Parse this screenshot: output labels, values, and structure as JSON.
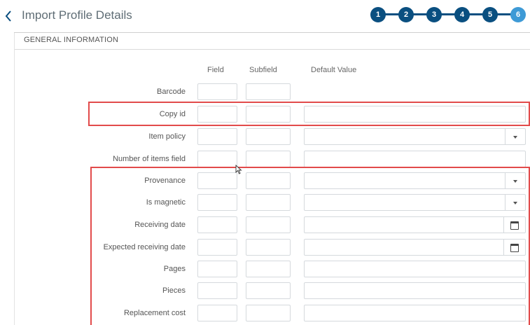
{
  "header": {
    "back_icon": "chevron-left-icon",
    "title": "Import Profile Details",
    "steps": [
      "1",
      "2",
      "3",
      "4",
      "5",
      "6"
    ],
    "active_step": "6"
  },
  "section": {
    "title": "GENERAL INFORMATION",
    "columns": {
      "field": "Field",
      "subfield": "Subfield",
      "default_value": "Default Value"
    }
  },
  "rows": [
    {
      "label": "Barcode",
      "default_control": "none"
    },
    {
      "label": "Copy id",
      "default_control": "text"
    },
    {
      "label": "Item policy",
      "default_control": "dropdown"
    },
    {
      "label": "Number of items field",
      "default_control": "text"
    },
    {
      "label": "Provenance",
      "default_control": "dropdown"
    },
    {
      "label": "Is magnetic",
      "default_control": "dropdown"
    },
    {
      "label": "Receiving date",
      "default_control": "date"
    },
    {
      "label": "Expected receiving date",
      "default_control": "date"
    },
    {
      "label": "Pages",
      "default_control": "text"
    },
    {
      "label": "Pieces",
      "default_control": "text"
    },
    {
      "label": "Replacement cost",
      "default_control": "text"
    }
  ],
  "colors": {
    "step": "#0a4f80",
    "step_active": "#3e9ad6",
    "highlight": "#e24b4b"
  }
}
